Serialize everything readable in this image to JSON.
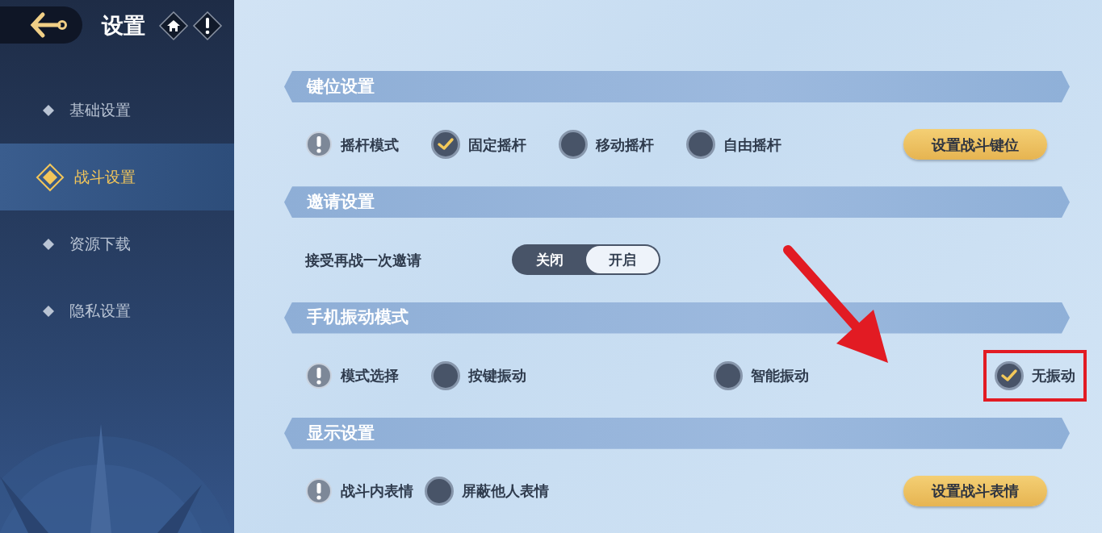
{
  "header": {
    "title": "设置"
  },
  "sidebar": {
    "items": [
      {
        "label": "基础设置",
        "selected": false
      },
      {
        "label": "战斗设置",
        "selected": true
      },
      {
        "label": "资源下载",
        "selected": false
      },
      {
        "label": "隐私设置",
        "selected": false
      }
    ]
  },
  "sections": [
    {
      "title": "键位设置",
      "items": [
        {
          "kind": "info",
          "label": "摇杆模式"
        },
        {
          "kind": "radio",
          "label": "固定摇杆",
          "selected": true,
          "highlighted": false
        },
        {
          "kind": "radio",
          "label": "移动摇杆",
          "selected": false,
          "highlighted": false
        },
        {
          "kind": "radio",
          "label": "自由摇杆",
          "selected": false,
          "highlighted": false
        },
        {
          "kind": "button",
          "label": "设置战斗键位"
        }
      ]
    },
    {
      "title": "邀请设置",
      "items": [
        {
          "kind": "text",
          "label": "接受再战一次邀请"
        },
        {
          "kind": "toggle",
          "options": [
            {
              "label": "关闭",
              "selected": false
            },
            {
              "label": "开启",
              "selected": true
            }
          ]
        }
      ]
    },
    {
      "title": "手机振动模式",
      "items": [
        {
          "kind": "info",
          "label": "模式选择"
        },
        {
          "kind": "radio",
          "label": "按键振动",
          "selected": false,
          "highlighted": false
        },
        {
          "kind": "radio",
          "label": "智能振动",
          "selected": false,
          "highlighted": false
        },
        {
          "kind": "radio",
          "label": "无振动",
          "selected": true,
          "highlighted": true
        }
      ]
    },
    {
      "title": "显示设置",
      "items": [
        {
          "kind": "info",
          "label": "战斗内表情"
        },
        {
          "kind": "radio",
          "label": "屏蔽他人表情",
          "selected": false,
          "highlighted": false
        },
        {
          "kind": "button",
          "label": "设置战斗表情"
        }
      ]
    }
  ]
}
